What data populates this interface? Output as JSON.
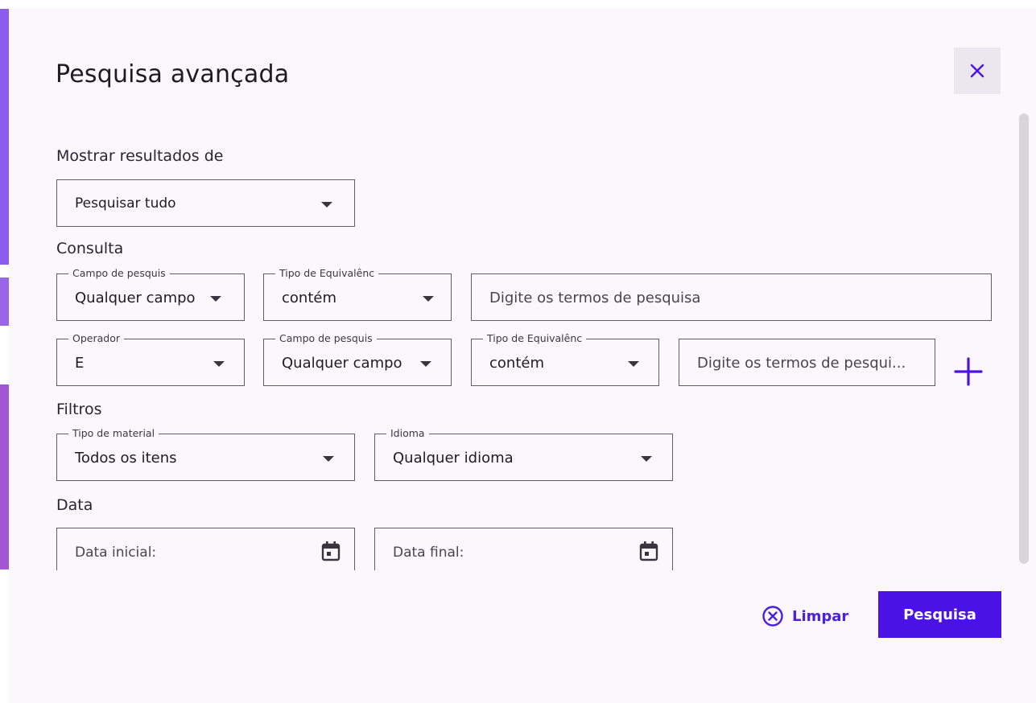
{
  "colors": {
    "accent": "#4a12e5",
    "dialog_bg": "#fbf7fc",
    "field_border": "#625b6a"
  },
  "dialog": {
    "title": "Pesquisa avançada",
    "close_icon": "close-icon"
  },
  "show_results": {
    "label": "Mostrar resultados de",
    "value": "Pesquisar tudo"
  },
  "query": {
    "label": "Consulta",
    "row1": {
      "field_legend": "Campo de pesquis",
      "field_value": "Qualquer campo",
      "match_legend": "Tipo de Equivalênc",
      "match_value": "contém",
      "term_placeholder": "Digite os termos de pesquisa"
    },
    "row2": {
      "operator_legend": "Operador",
      "operator_value": "E",
      "field_legend": "Campo de pesquis",
      "field_value": "Qualquer campo",
      "match_legend": "Tipo de Equivalênc",
      "match_value": "contém",
      "term_placeholder": "Digite os termos de pesqui..."
    },
    "add_icon": "plus-icon"
  },
  "filters": {
    "label": "Filtros",
    "material_legend": "Tipo de material",
    "material_value": "Todos os itens",
    "language_legend": "Idioma",
    "language_value": "Qualquer idioma"
  },
  "date": {
    "label": "Data",
    "start_placeholder": "Data inicial:",
    "end_placeholder": "Data final:",
    "calendar_icon": "calendar-icon"
  },
  "footer": {
    "clear_label": "Limpar",
    "clear_icon": "circle-x-icon",
    "search_label": "Pesquisa"
  }
}
